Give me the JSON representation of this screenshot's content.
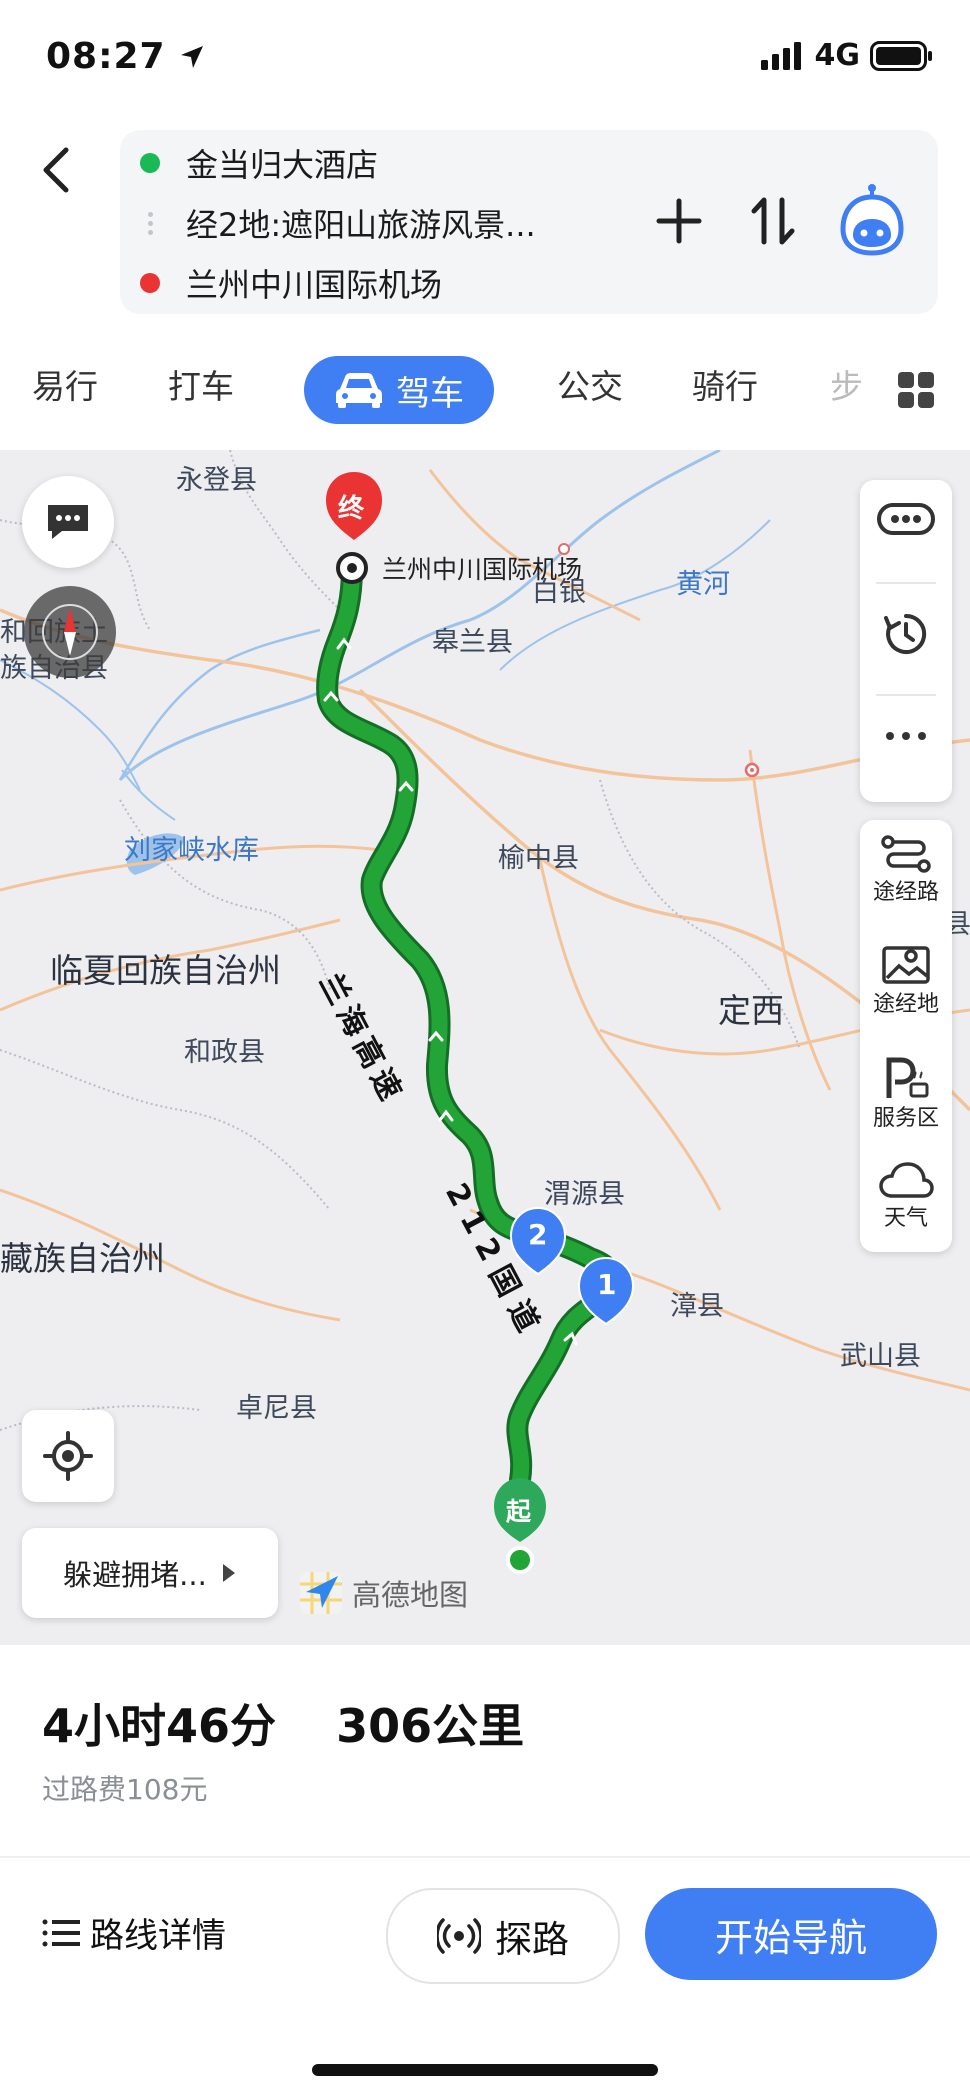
{
  "status_bar": {
    "time": "08:27",
    "carrier": "4G"
  },
  "route": {
    "origin": "金当归大酒店",
    "waypoints": "经2地:遮阳山旅游风景...",
    "destination": "兰州中川国际机场",
    "colors": {
      "origin": "#19b955",
      "destination": "#ea3434"
    }
  },
  "tabs": {
    "items": [
      "易行",
      "打车",
      "驾车",
      "公交",
      "骑行",
      "步"
    ],
    "active": "驾车"
  },
  "map": {
    "labels": {
      "yongdeng": "永登县",
      "airport": "兰州中川国际机场",
      "baiyin": "白银",
      "yellow_river": "黄河",
      "gaolan": "皋兰县",
      "heping_zu": "和回族土",
      "zu_zizhi": "族自治县",
      "liujiaxia": "刘家峡水库",
      "yuzhong": "榆中县",
      "linxia": "临夏回族自治州",
      "hezheng": "和政县",
      "dingxi": "定西",
      "weiyuan": "渭源县",
      "zangzu": "藏族自治州",
      "zhangxian": "漳县",
      "wushan": "武山县",
      "zhuoni": "卓尼县",
      "highway": "兰海高速",
      "national_road": "212国道",
      "xian_partial": "县"
    },
    "markers": {
      "end": "终",
      "start": "起",
      "wp1": "1",
      "wp2": "2"
    },
    "side_panel": {
      "waypoint_road": "途经路",
      "waypoint_place": "途经地",
      "service_area": "服务区",
      "weather": "天气"
    },
    "avoid_congestion": "躲避拥堵...",
    "brand": "高德地图",
    "route_color": "#23a437"
  },
  "summary": {
    "duration": "4小时46分",
    "distance": "306公里",
    "toll": "过路费108元"
  },
  "actions": {
    "details": "路线详情",
    "probe": "探路",
    "start": "开始导航"
  },
  "accent": "#3f7ef3"
}
